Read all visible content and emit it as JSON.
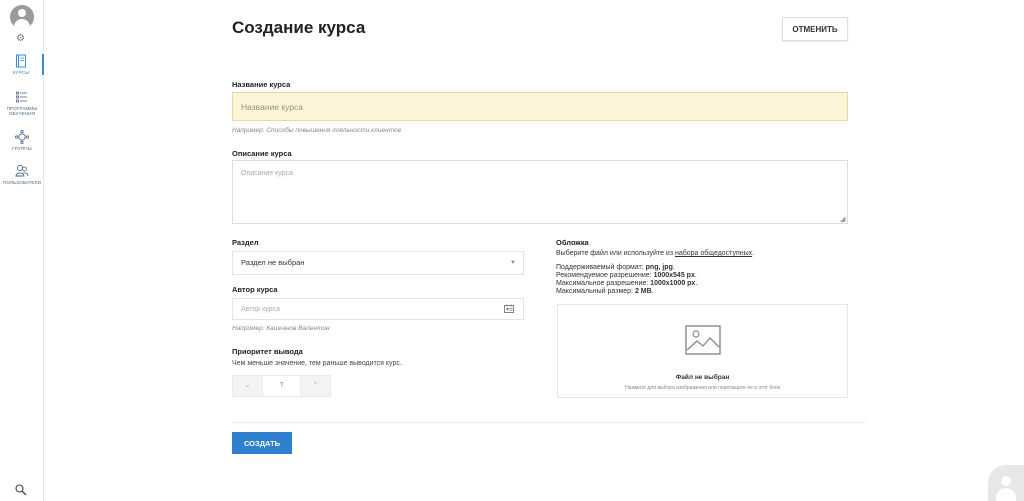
{
  "sidebar": {
    "items": [
      {
        "label": "КУРСЫ",
        "icon": "courses-icon"
      },
      {
        "label": "ПРОГРАММЫ ОБУЧЕНИЯ",
        "icon": "programs-icon"
      },
      {
        "label": "ГРУППЫ",
        "icon": "groups-icon"
      },
      {
        "label": "ПОЛЬЗОВАТЕЛИ",
        "icon": "users-icon"
      }
    ],
    "active_color": "#3a8bd8"
  },
  "header": {
    "title": "Создание курса",
    "cancel_label": "ОТМЕНИТЬ"
  },
  "form": {
    "name": {
      "label": "Название курса",
      "placeholder": "Название курса",
      "hint": "Например: Способы повышения лояльности клиентов"
    },
    "description": {
      "label": "Описание курса",
      "placeholder": "Описание курса"
    },
    "section": {
      "label": "Раздел",
      "value": "Раздел не выбран"
    },
    "author": {
      "label": "Автор курса",
      "placeholder": "Автор курса",
      "hint": "Например: Кашканов Валентин"
    },
    "priority": {
      "label": "Приоритет вывода",
      "description": "Чем меньше значение, тем раньше выводится курс.",
      "value": "?",
      "minus": "⌄",
      "plus": "⌃"
    },
    "cover": {
      "label": "Обложка",
      "line1_prefix": "Выберите файл или используйте из ",
      "line1_link": "набора общедоступных",
      "line1_suffix": ".",
      "format_prefix": "Поддерживаемый формат: ",
      "format_value": "png, jpg",
      "format_suffix": ".",
      "recommended_prefix": "Рекомендуемое разрешение: ",
      "recommended_value": "1000x545 px",
      "recommended_suffix": ".",
      "max_res_prefix": "Максимальное разрешение: ",
      "max_res_value": "1000x1000 px",
      "max_res_suffix": ".",
      "max_size_prefix": "Максимальный размер: ",
      "max_size_value": "2 MB",
      "max_size_suffix": ".",
      "dropzone_title": "Файл не выбран",
      "dropzone_sub": "Нажмите для выбора изображения или перетащите ее в этот блок"
    },
    "submit_label": "СОЗДАТЬ"
  },
  "colors": {
    "primary": "#2f7fcf",
    "name_input_bg": "#fcf4d9"
  }
}
